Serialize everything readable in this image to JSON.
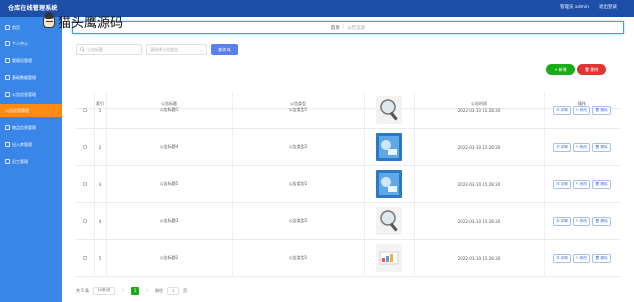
{
  "app": {
    "title": "仓库在线管理系统",
    "user": "管理员 admin",
    "logout": "退出登录"
  },
  "watermark": {
    "text": "猫头鹰源码"
  },
  "sidebar": {
    "items": [
      {
        "label": "首页",
        "active": false
      },
      {
        "label": "个人中心",
        "active": false
      },
      {
        "label": "管理员管理",
        "active": false
      },
      {
        "label": "基础数据管理",
        "active": false
      },
      {
        "label": "公告信息管理",
        "active": false
      },
      {
        "label": "公告信息管理",
        "active": true
      },
      {
        "label": "物品信息管理",
        "active": false
      },
      {
        "label": "出入库管理",
        "active": false
      },
      {
        "label": "员工管理",
        "active": false
      }
    ]
  },
  "breadcrumb": {
    "home": "首页",
    "separator": "/",
    "current": "公告信息"
  },
  "search": {
    "title_placeholder": "公告标题",
    "type_placeholder": "请选择公告类型",
    "query_label": "查询"
  },
  "toolbar": {
    "add_label": "新增",
    "delete_label": "删除"
  },
  "table": {
    "headers": [
      "索引",
      "公告标题",
      "公告类型",
      "公告图片",
      "公告时间",
      "操作"
    ],
    "rows": [
      {
        "index": "1",
        "title": "公告标题1",
        "type": "公告类型1",
        "time": "2022-03-10 15:28:30",
        "image": "magnifier"
      },
      {
        "index": "2",
        "title": "公告标题4",
        "type": "公告类型2",
        "time": "2022-03-10 15:28:30",
        "image": "blue-poster"
      },
      {
        "index": "3",
        "title": "公告标题5",
        "type": "公告类型2",
        "time": "2022-03-10 15:28:30",
        "image": "blue-poster"
      },
      {
        "index": "4",
        "title": "公告标题3",
        "type": "公告类型2",
        "time": "2022-03-10 15:28:30",
        "image": "magnifier"
      },
      {
        "index": "5",
        "title": "公告标题2",
        "type": "公告类型2",
        "time": "2022-03-10 15:28:30",
        "image": "chart-card"
      }
    ],
    "actions": {
      "detail": "详情",
      "edit": "修改",
      "delete": "删除"
    }
  },
  "pagination": {
    "total": "共 5 条",
    "page_size": "10条/页",
    "current_page": "1",
    "goto_label": "前往",
    "goto_value": "1",
    "page_unit": "页"
  },
  "colors": {
    "topbar": "#1e4fa8",
    "sidebar": "#3a86e8",
    "active": "#ff8b12",
    "add": "#1aad19",
    "delete": "#e23434",
    "query": "#5a7ff0"
  }
}
